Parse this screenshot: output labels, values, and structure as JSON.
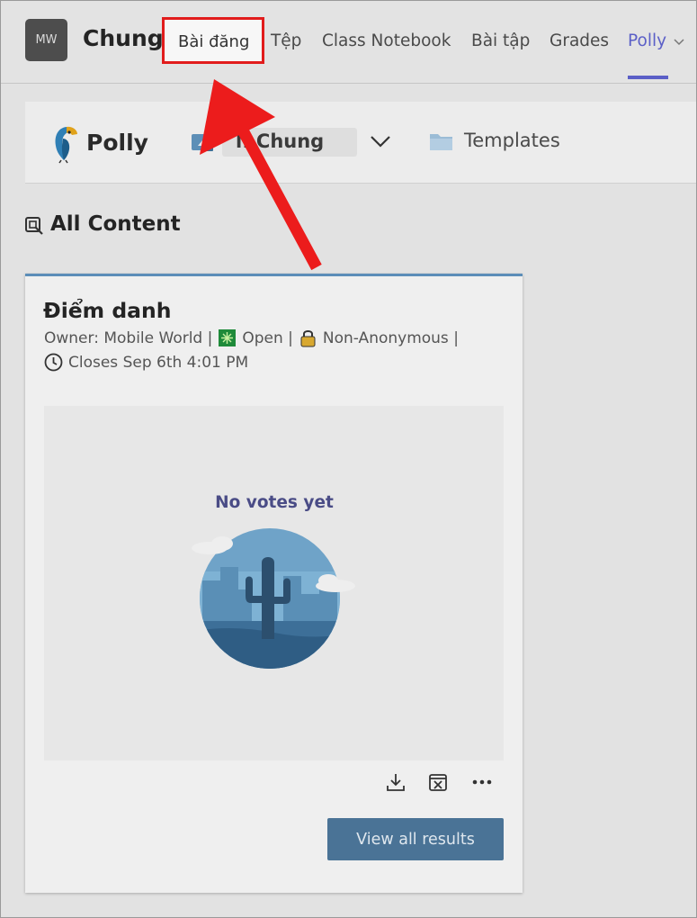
{
  "header": {
    "avatar_initials": "MW",
    "team_name": "Chung",
    "tabs": [
      {
        "label": "Bài đăng",
        "highlighted": true
      },
      {
        "label": "Tệp"
      },
      {
        "label": "Class Notebook"
      },
      {
        "label": "Bài tập"
      },
      {
        "label": "Grades"
      },
      {
        "label": "Polly",
        "active": true
      }
    ],
    "active_tab_color": "#5b5fc7"
  },
  "appbar": {
    "app_title": "Polly",
    "channel_label": "l: Chung",
    "templates_label": "Templates"
  },
  "section": {
    "title": "All Content"
  },
  "card": {
    "title": "Điểm danh",
    "owner": "Owner: Mobile World |",
    "status": "Open |",
    "anonymity": "Non-Anonymous |",
    "closes": "Closes Sep 6th 4:01 PM",
    "empty_message": "No votes yet",
    "view_all_label": "View all results",
    "accent_color": "#5b8db8"
  },
  "annotation": {
    "highlight_color": "#e11c1c",
    "arrow_color": "#ec1c1c"
  }
}
